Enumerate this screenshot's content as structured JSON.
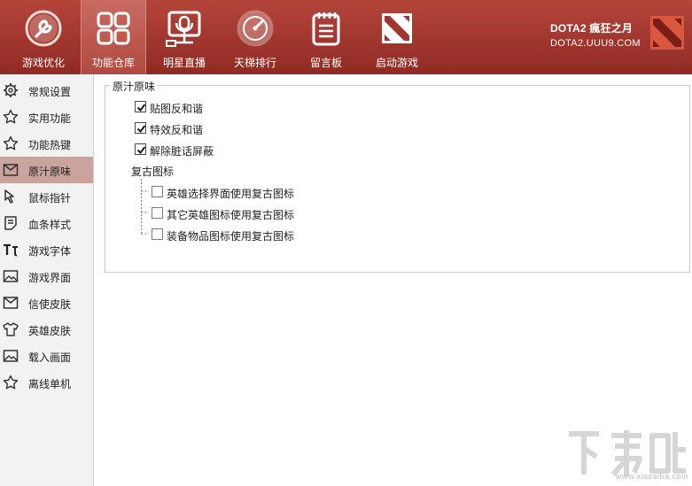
{
  "topnav": {
    "items": [
      {
        "label": "游戏优化",
        "icon": "wrench-icon"
      },
      {
        "label": "功能仓库",
        "icon": "grid-icon",
        "active": true
      },
      {
        "label": "明星直播",
        "icon": "live-stream-icon"
      },
      {
        "label": "天梯排行",
        "icon": "gauge-icon"
      },
      {
        "label": "留言板",
        "icon": "notepad-icon"
      },
      {
        "label": "启动游戏",
        "icon": "dota-logo-icon"
      }
    ]
  },
  "brand": {
    "title": "DOTA2 瘋狂之月",
    "subtitle": "DOTA2.UUU9.COM"
  },
  "sidebar": {
    "items": [
      {
        "label": "常规设置",
        "icon": "gear-icon"
      },
      {
        "label": "实用功能",
        "icon": "star-icon"
      },
      {
        "label": "功能热键",
        "icon": "star-icon"
      },
      {
        "label": "原汁原味",
        "icon": "envelope-icon",
        "active": true
      },
      {
        "label": "鼠标指针",
        "icon": "cursor-icon"
      },
      {
        "label": "血条样式",
        "icon": "healthbar-icon"
      },
      {
        "label": "游戏字体",
        "icon": "font-icon"
      },
      {
        "label": "游戏界面",
        "icon": "image-icon"
      },
      {
        "label": "信使皮肤",
        "icon": "mail-icon"
      },
      {
        "label": "英雄皮肤",
        "icon": "shirt-icon"
      },
      {
        "label": "载入画面",
        "icon": "image-icon"
      },
      {
        "label": "离线单机",
        "icon": "star-icon"
      }
    ]
  },
  "content": {
    "group_title": "原汁原味",
    "options": [
      {
        "label": "贴图反和谐",
        "checked": true
      },
      {
        "label": "特效反和谐",
        "checked": true
      },
      {
        "label": "解除脏话屏蔽",
        "checked": true
      }
    ],
    "sub_group_title": "复古图标",
    "sub_options": [
      {
        "label": "英雄选择界面使用复古图标",
        "checked": false
      },
      {
        "label": "其它英雄图标使用复古图标",
        "checked": false
      },
      {
        "label": "装备物品图标使用复古图标",
        "checked": false
      }
    ]
  },
  "watermark": {
    "text": "下载吧",
    "url": "www.xiazaiba.com"
  },
  "colors": {
    "topbar": "#a0372f",
    "active_nav": "#c0594f",
    "sidebar_active": "#c9a39c",
    "sidebar_bg": "#f2f2f2"
  }
}
